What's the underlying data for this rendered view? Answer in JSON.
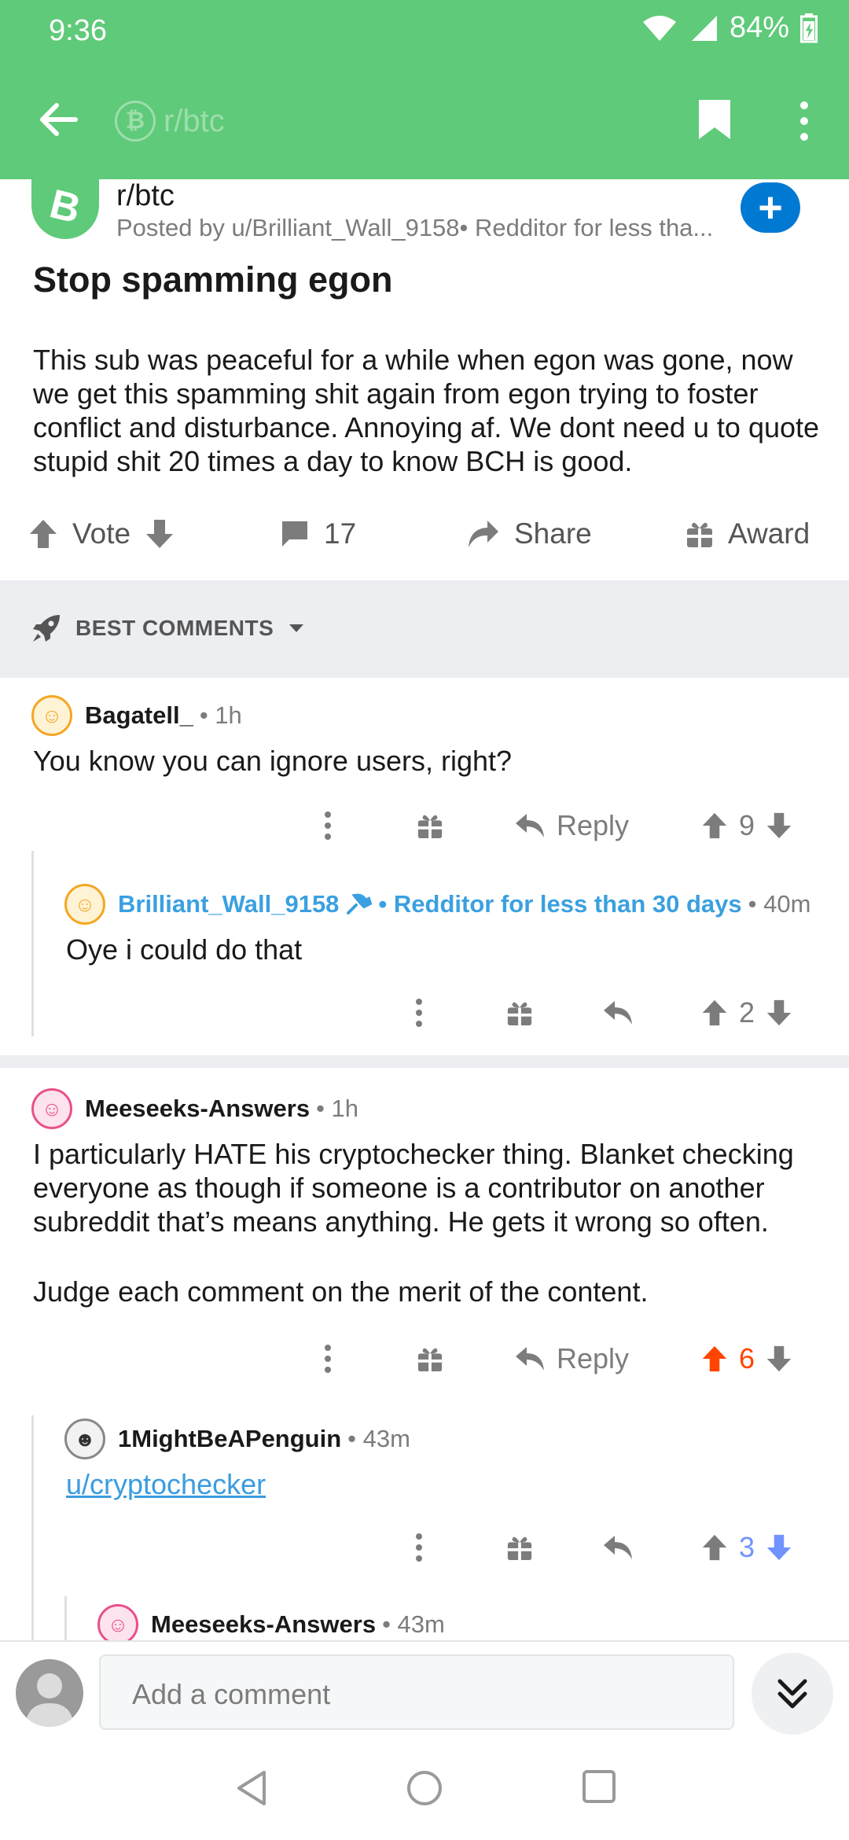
{
  "status_bar": {
    "time": "9:36",
    "battery": "84%"
  },
  "app_bar": {
    "subreddit_title": "r/btc",
    "subreddit_icon": "bitcoin-cash-icon"
  },
  "post": {
    "subreddit": "r/btc",
    "posted_by": "Posted by u/Brilliant_Wall_9158• Redditor for less tha...",
    "join_symbol": "+",
    "title": "Stop spamming egon",
    "body": "This sub was peaceful for a while when egon was gone, now we get this spamming shit again from egon trying to foster conflict and disturbance. Annoying af. We dont need u to quote stupid shit 20 times a day to know BCH is good.",
    "actions": {
      "vote_label": "Vote",
      "comments_count": "17",
      "share_label": "Share",
      "award_label": "Award"
    }
  },
  "sort": {
    "label": "BEST COMMENTS"
  },
  "comments": [
    {
      "author": "Bagatell_",
      "time": "• 1h",
      "text": "You know you can ignore users, right?",
      "reply_label": "Reply",
      "score": "9"
    },
    {
      "author": "Brilliant_Wall_9158",
      "badge": "• Redditor for less than 30 days",
      "time": "• 40m",
      "text": "Oye i could do that",
      "score": "2"
    },
    {
      "author": "Meeseeks-Answers",
      "time": "• 1h",
      "text_p1": "I particularly HATE his cryptochecker thing. Blanket checking everyone as though if someone is a contributor on another subreddit that’s means anything. He gets it wrong so often.",
      "text_p2": "Judge each comment on the merit of the content.",
      "reply_label": "Reply",
      "score": "6"
    },
    {
      "author": "1MightBeAPenguin",
      "time": "• 43m",
      "link": "u/cryptochecker",
      "score": "3"
    },
    {
      "author": "Meeseeks-Answers",
      "time": "• 43m"
    }
  ],
  "comment_bar": {
    "placeholder": "Add a comment"
  },
  "colors": {
    "brand_green": "#5fca79",
    "upvote_orange": "#ff4500",
    "downvote_blue": "#7193ff",
    "op_blue": "#3aa0e0",
    "join_blue": "#0079d3"
  }
}
